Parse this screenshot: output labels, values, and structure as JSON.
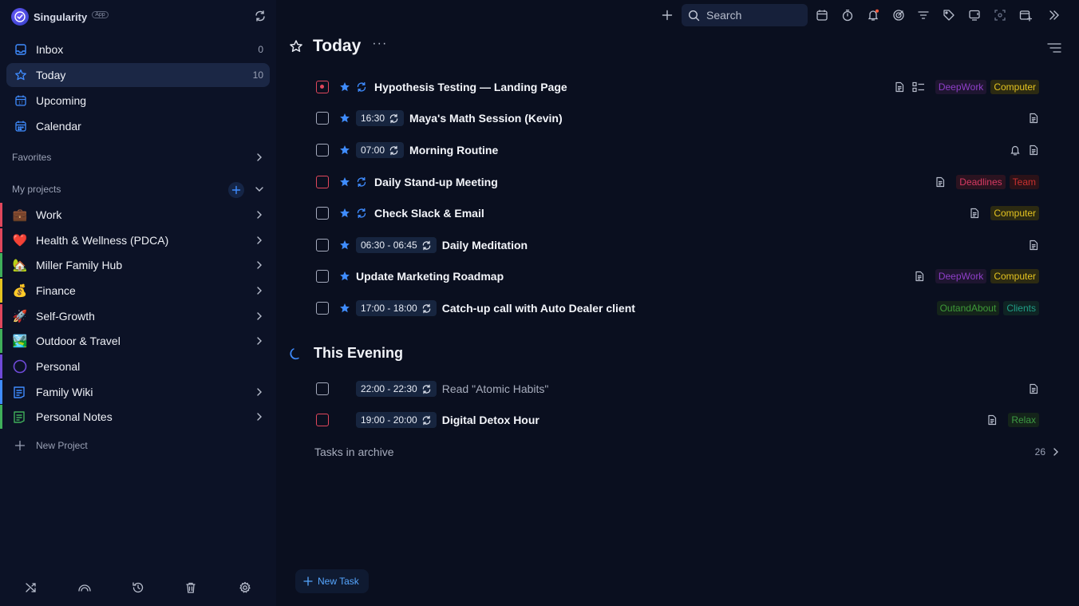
{
  "app": {
    "name": "Singularity",
    "badge": "App"
  },
  "colors": {
    "accent": "#3f8cff",
    "active_bg": "#1b2745",
    "red_priority": "#e0475c"
  },
  "sidebar": {
    "nav": [
      {
        "label": "Inbox",
        "count": "0",
        "icon": "inbox-icon"
      },
      {
        "label": "Today",
        "count": "10",
        "icon": "star-icon"
      },
      {
        "label": "Upcoming",
        "count": "",
        "icon": "calendar-upcoming-icon"
      },
      {
        "label": "Calendar",
        "count": "",
        "icon": "calendar-icon"
      }
    ],
    "favorites_label": "Favorites",
    "projects_label": "My projects",
    "projects": [
      {
        "label": "Work",
        "emoji": "💼",
        "color": "#e0475c"
      },
      {
        "label": "Health & Wellness (PDCA)",
        "emoji": "❤️",
        "color": "#e0475c"
      },
      {
        "label": "Miller Family Hub",
        "emoji": "🏡",
        "color": "#3fae5a"
      },
      {
        "label": "Finance",
        "emoji": "💰",
        "color": "#e4c320"
      },
      {
        "label": "Self-Growth",
        "emoji": "🚀",
        "color": "#e0475c"
      },
      {
        "label": "Outdoor & Travel",
        "emoji": "🏞️",
        "color": "#3fae5a"
      },
      {
        "label": "Personal",
        "emoji": "",
        "color": "#6f4ad8"
      },
      {
        "label": "Family Wiki",
        "emoji": "",
        "color": "#3f8cff"
      },
      {
        "label": "Personal Notes",
        "emoji": "",
        "color": "#3fae5a"
      }
    ],
    "new_project_label": "New Project"
  },
  "toolbar": {
    "search_placeholder": "Search"
  },
  "main": {
    "title": "Today",
    "evening_title": "This Evening",
    "archive_label": "Tasks in archive",
    "archive_count": "26",
    "new_task_label": "New Task",
    "tasks": [
      {
        "title": "Hypothesis Testing — Landing Page",
        "time": "",
        "tags": [
          "DeepWork",
          "Computer"
        ]
      },
      {
        "title": "Maya's Math Session (Kevin)",
        "time": "16:30",
        "tags": []
      },
      {
        "title": "Morning Routine",
        "time": "07:00",
        "tags": []
      },
      {
        "title": "Daily Stand-up Meeting",
        "time": "",
        "tags": [
          "Deadlines",
          "Team"
        ]
      },
      {
        "title": "Check Slack & Email",
        "time": "",
        "tags": [
          "Computer"
        ]
      },
      {
        "title": "Daily Meditation",
        "time": "06:30 - 06:45",
        "tags": []
      },
      {
        "title": "Update Marketing Roadmap",
        "time": "",
        "tags": [
          "DeepWork",
          "Computer"
        ]
      },
      {
        "title": "Catch-up call with Auto Dealer client",
        "time": "17:00 - 18:00",
        "tags": [
          "OutandAbout",
          "Clients"
        ]
      }
    ],
    "evening_tasks": [
      {
        "title": "Read \"Atomic Habits\"",
        "time": "22:00 - 22:30",
        "tags": []
      },
      {
        "title": "Digital Detox Hour",
        "time": "19:00 - 20:00",
        "tags": [
          "Relax"
        ]
      }
    ]
  }
}
